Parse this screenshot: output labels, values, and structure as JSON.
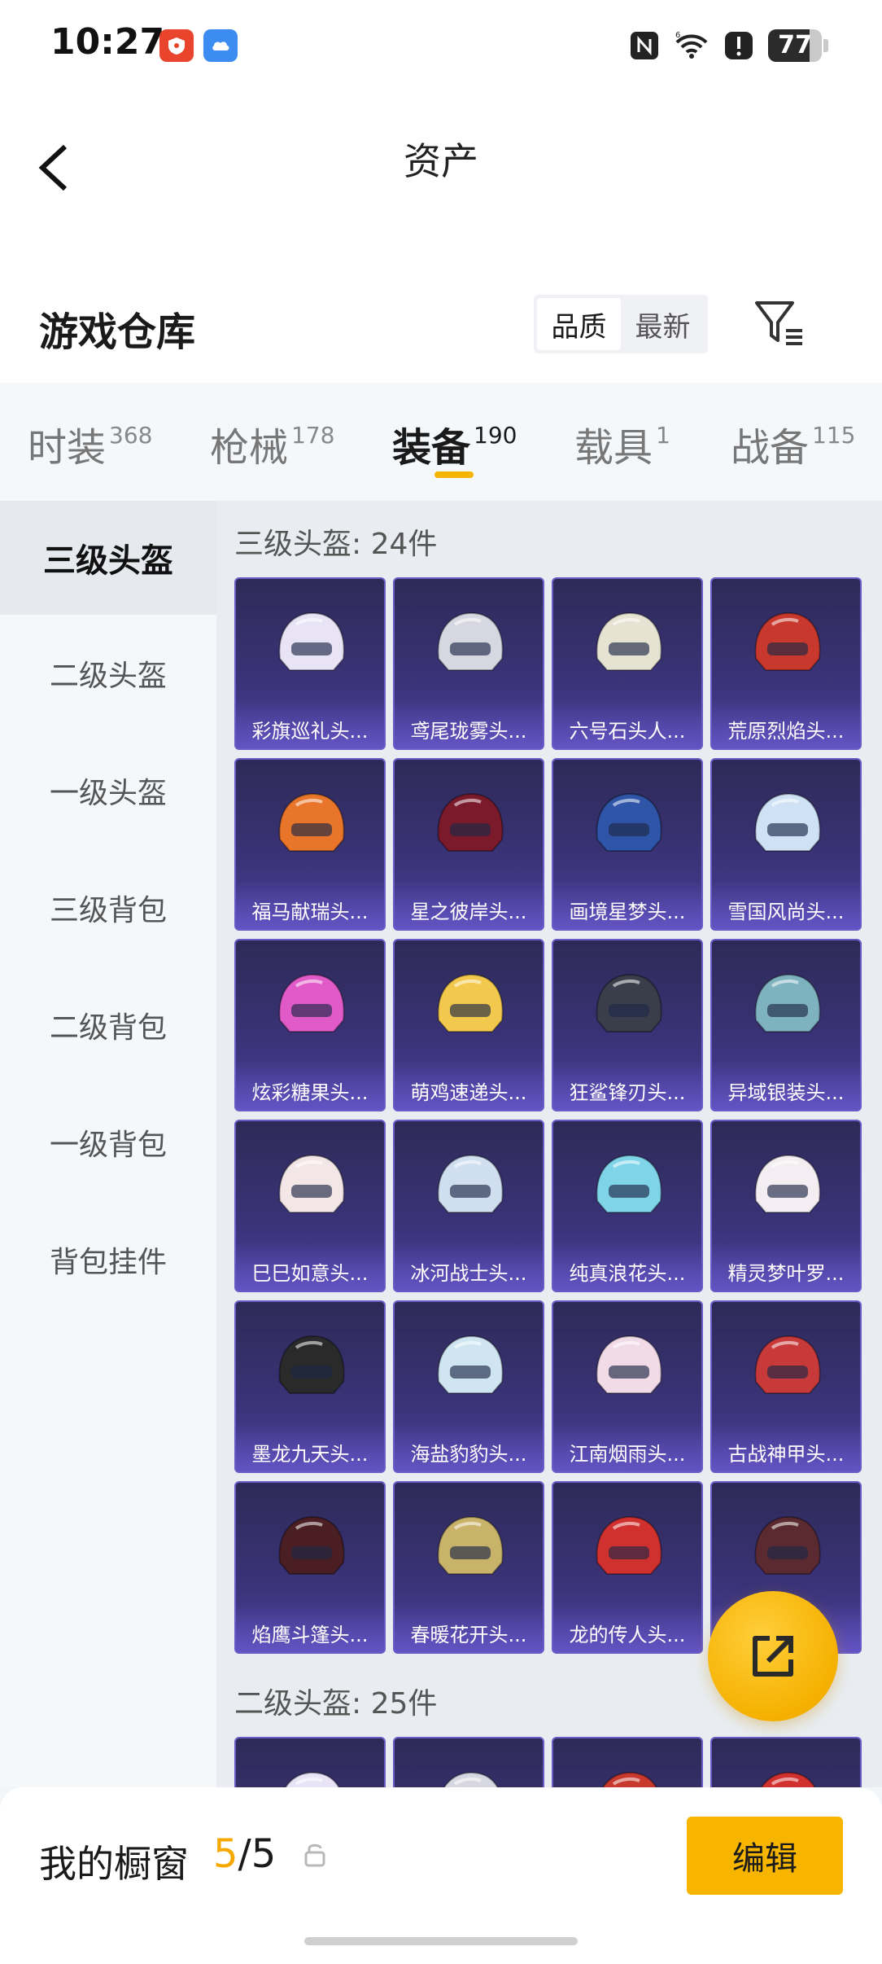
{
  "status_bar": {
    "time": "10:27",
    "battery": "77",
    "battery_level": 0.77
  },
  "header": {
    "title": "资产"
  },
  "section": {
    "title": "游戏仓库",
    "sort_options": [
      "品质",
      "最新"
    ],
    "sort_active": "品质"
  },
  "tabs": [
    {
      "label": "时装",
      "count": "368"
    },
    {
      "label": "枪械",
      "count": "178"
    },
    {
      "label": "装备",
      "count": "190",
      "active": true
    },
    {
      "label": "载具",
      "count": "1"
    },
    {
      "label": "战备",
      "count": "115"
    }
  ],
  "sidebar": {
    "items": [
      {
        "label": "三级头盔",
        "active": true
      },
      {
        "label": "二级头盔"
      },
      {
        "label": "一级头盔"
      },
      {
        "label": "三级背包"
      },
      {
        "label": "二级背包"
      },
      {
        "label": "一级背包"
      },
      {
        "label": "背包挂件"
      }
    ]
  },
  "content": {
    "groups": [
      {
        "header": "三级头盔: 24件",
        "items": [
          {
            "name": "彩旗巡礼头...",
            "color": "#e9e4f5"
          },
          {
            "name": "鸢尾珑雾头...",
            "color": "#d7d7e2"
          },
          {
            "name": "六号石头人...",
            "color": "#e6e3d2"
          },
          {
            "name": "荒原烈焰头...",
            "color": "#c9382c"
          },
          {
            "name": "福马献瑞头...",
            "color": "#e8752a"
          },
          {
            "name": "星之彼岸头...",
            "color": "#7a1a2a"
          },
          {
            "name": "画境星梦头...",
            "color": "#2f55a8"
          },
          {
            "name": "雪国风尚头...",
            "color": "#cfe2f5"
          },
          {
            "name": "炫彩糖果头...",
            "color": "#e05bc8"
          },
          {
            "name": "萌鸡速递头...",
            "color": "#f2c94c"
          },
          {
            "name": "狂鲨锋刃头...",
            "color": "#3a3e4a"
          },
          {
            "name": "异域银装头...",
            "color": "#7fb2bf"
          },
          {
            "name": "巳巳如意头...",
            "color": "#f3e6e6"
          },
          {
            "name": "冰河战士头...",
            "color": "#cfdff0"
          },
          {
            "name": "纯真浪花头...",
            "color": "#7fd4e8"
          },
          {
            "name": "精灵梦叶罗...",
            "color": "#f4eef2"
          },
          {
            "name": "墨龙九天头...",
            "color": "#2a2a2a"
          },
          {
            "name": "海盐豹豹头...",
            "color": "#cfe6f2"
          },
          {
            "name": "江南烟雨头...",
            "color": "#f0dbe6"
          },
          {
            "name": "古战神甲头...",
            "color": "#c83a3a"
          },
          {
            "name": "焰鹰斗篷头...",
            "color": "#4a1e22"
          },
          {
            "name": "春暖花开头...",
            "color": "#c9b26a"
          },
          {
            "name": "龙的传人头...",
            "color": "#d0302e"
          },
          {
            "name": "",
            "color": "#5a2a30"
          }
        ]
      },
      {
        "header": "二级头盔: 25件",
        "items": [
          {
            "name": "",
            "color": "#e9e4f5"
          },
          {
            "name": "",
            "color": "#d7d7e2"
          },
          {
            "name": "",
            "color": "#c9382c"
          },
          {
            "name": "",
            "color": "#d0302e"
          }
        ]
      }
    ]
  },
  "showcase": {
    "title": "我的橱窗",
    "current": "5",
    "total": "/5",
    "edit_label": "编辑"
  }
}
